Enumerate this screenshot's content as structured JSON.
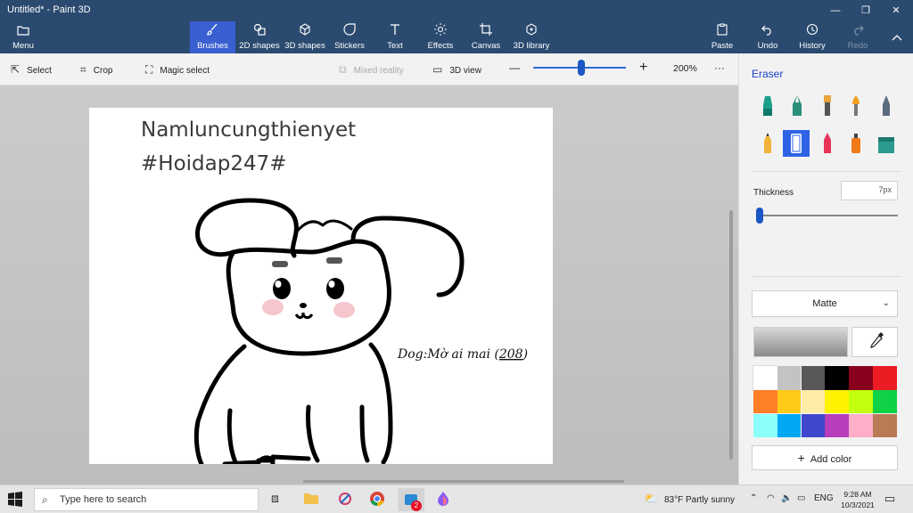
{
  "window": {
    "title": "Untitled* - Paint 3D",
    "minimize_glyph": "—",
    "maximize_glyph": "❐",
    "close_glyph": "✕"
  },
  "ribbon": {
    "menu": {
      "label": "Menu",
      "icon": "folder-icon"
    },
    "tabs": [
      {
        "label": "Brushes",
        "icon": "brush-icon",
        "active": true
      },
      {
        "label": "2D shapes",
        "icon": "shapes-2d-icon"
      },
      {
        "label": "3D shapes",
        "icon": "cube-icon"
      },
      {
        "label": "Stickers",
        "icon": "sticker-icon"
      },
      {
        "label": "Text",
        "icon": "text-icon"
      },
      {
        "label": "Effects",
        "icon": "sun-icon"
      },
      {
        "label": "Canvas",
        "icon": "crop-canvas-icon"
      },
      {
        "label": "3D library",
        "icon": "library-icon"
      }
    ],
    "right": [
      {
        "label": "Paste",
        "icon": "paste-icon"
      },
      {
        "label": "Undo",
        "icon": "undo-icon"
      },
      {
        "label": "History",
        "icon": "history-icon"
      },
      {
        "label": "Redo",
        "icon": "redo-icon",
        "disabled": true
      }
    ]
  },
  "toolbar": {
    "select": "Select",
    "crop": "Crop",
    "magic_select": "Magic select",
    "mixed_reality": "Mixed reality",
    "view_3d": "3D view",
    "zoom_minus": "—",
    "zoom_plus": "+",
    "zoom_level": "200%",
    "zoom_fraction": 0.52,
    "more": "···"
  },
  "canvas": {
    "line1": "Namluncungthienyet",
    "line2": "#Hoidap247#",
    "caption_prefix": "Dog:Mờ ai mai (",
    "caption_code": "208",
    "caption_suffix": ")"
  },
  "panel": {
    "title": "Eraser",
    "brushes": [
      {
        "name": "marker",
        "color": "#1a9e8a"
      },
      {
        "name": "calligraphy-pen",
        "color": "#2a8f7c"
      },
      {
        "name": "oil-brush",
        "color": "#e8a33a"
      },
      {
        "name": "watercolor",
        "color": "#f0a020"
      },
      {
        "name": "pixel-pen",
        "color": "#5a6a80"
      },
      {
        "name": "pencil",
        "color": "#f2b33a"
      },
      {
        "name": "eraser",
        "color": "#ffffff",
        "selected": true
      },
      {
        "name": "crayon",
        "color": "#e8335a"
      },
      {
        "name": "spray-can",
        "color": "#f07a1a"
      },
      {
        "name": "fill",
        "color": "#2a9b8e"
      }
    ],
    "thickness_label": "Thickness",
    "thickness_value": "7px",
    "thickness_fraction": 0.02,
    "finish": "Matte",
    "palette": [
      "#ffffff",
      "#c3c3c3",
      "#585858",
      "#000000",
      "#88001b",
      "#ec1c24",
      "#ff7f27",
      "#ffca18",
      "#fdeca6",
      "#fff200",
      "#c4ff0e",
      "#0ed145",
      "#8cfffb",
      "#00a8f3",
      "#3f48cc",
      "#b83dba",
      "#ffaec8",
      "#b97a56"
    ],
    "add_color": "Add color"
  },
  "taskbar": {
    "search_placeholder": "Type here to search",
    "mail_badge": "2",
    "weather": "83°F  Partly sunny",
    "language": "ENG",
    "time": "9:28 AM",
    "date": "10/3/2021"
  }
}
